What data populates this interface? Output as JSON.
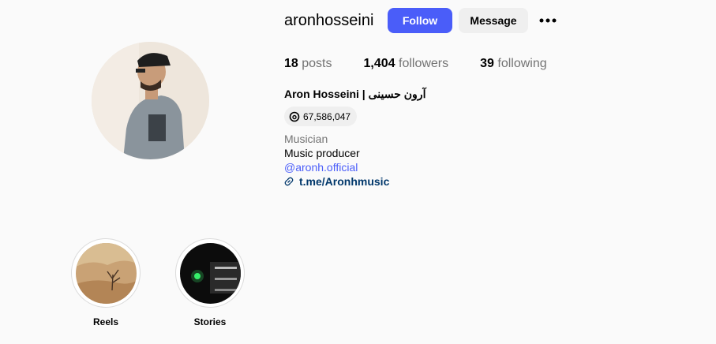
{
  "profile": {
    "username": "aronhosseini",
    "follow_label": "Follow",
    "message_label": "Message",
    "more_icon": "more-horizontal-icon",
    "stats": {
      "posts_count": "18",
      "posts_label": "posts",
      "followers_count": "1,404",
      "followers_label": "followers",
      "following_count": "39",
      "following_label": "following"
    },
    "full_name": "Aron Hosseini | آرون حسینی",
    "threads_count": "67,586,047",
    "category": "Musician",
    "bio": "Music producer",
    "mention": "@aronh.official",
    "link": "t.me/Aronhmusic"
  },
  "highlights": [
    {
      "label": "Reels"
    },
    {
      "label": "Stories"
    }
  ],
  "colors": {
    "accent": "#4a5df9",
    "link": "#00376b",
    "muted": "#737373",
    "button_bg": "#efefef"
  }
}
